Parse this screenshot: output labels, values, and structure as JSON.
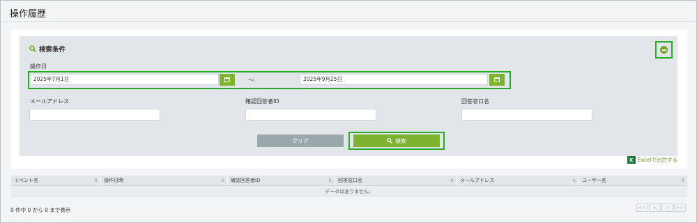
{
  "page": {
    "title": "操作履歴"
  },
  "search": {
    "heading": "検索条件",
    "collapse_icon": "minus-circle-icon",
    "operation_date_label": "操作日",
    "date_from": "2025年7月1日",
    "date_to": "2025年9月25日",
    "date_separator": "～",
    "email_label": "メールアドレス",
    "email_value": "",
    "confirm_responder_label": "確認回答者ID",
    "confirm_responder_value": "",
    "desk_name_label": "回答窓口名",
    "desk_name_value": "",
    "clear_label": "クリア",
    "search_label": "検索"
  },
  "excel": {
    "label": "Excelで出力する",
    "icon_text": "X"
  },
  "table": {
    "columns": [
      "イベント名",
      "操作日時",
      "確認回答者ID",
      "回答窓口名",
      "メールアドレス",
      "ユーザー名"
    ],
    "sort_mark": "⇅",
    "empty_message": "データはありません。"
  },
  "footer": {
    "count_text": "0 件中 0 から 0 まで表示",
    "pager": {
      "first": "<<",
      "prev": "<",
      "next": ">",
      "last": ">>"
    }
  },
  "colors": {
    "accent_green": "#7db32f",
    "highlight_frame": "#2aa82a",
    "panel_bg": "#e1e6e8",
    "clear_gray": "#9aa7ab"
  }
}
